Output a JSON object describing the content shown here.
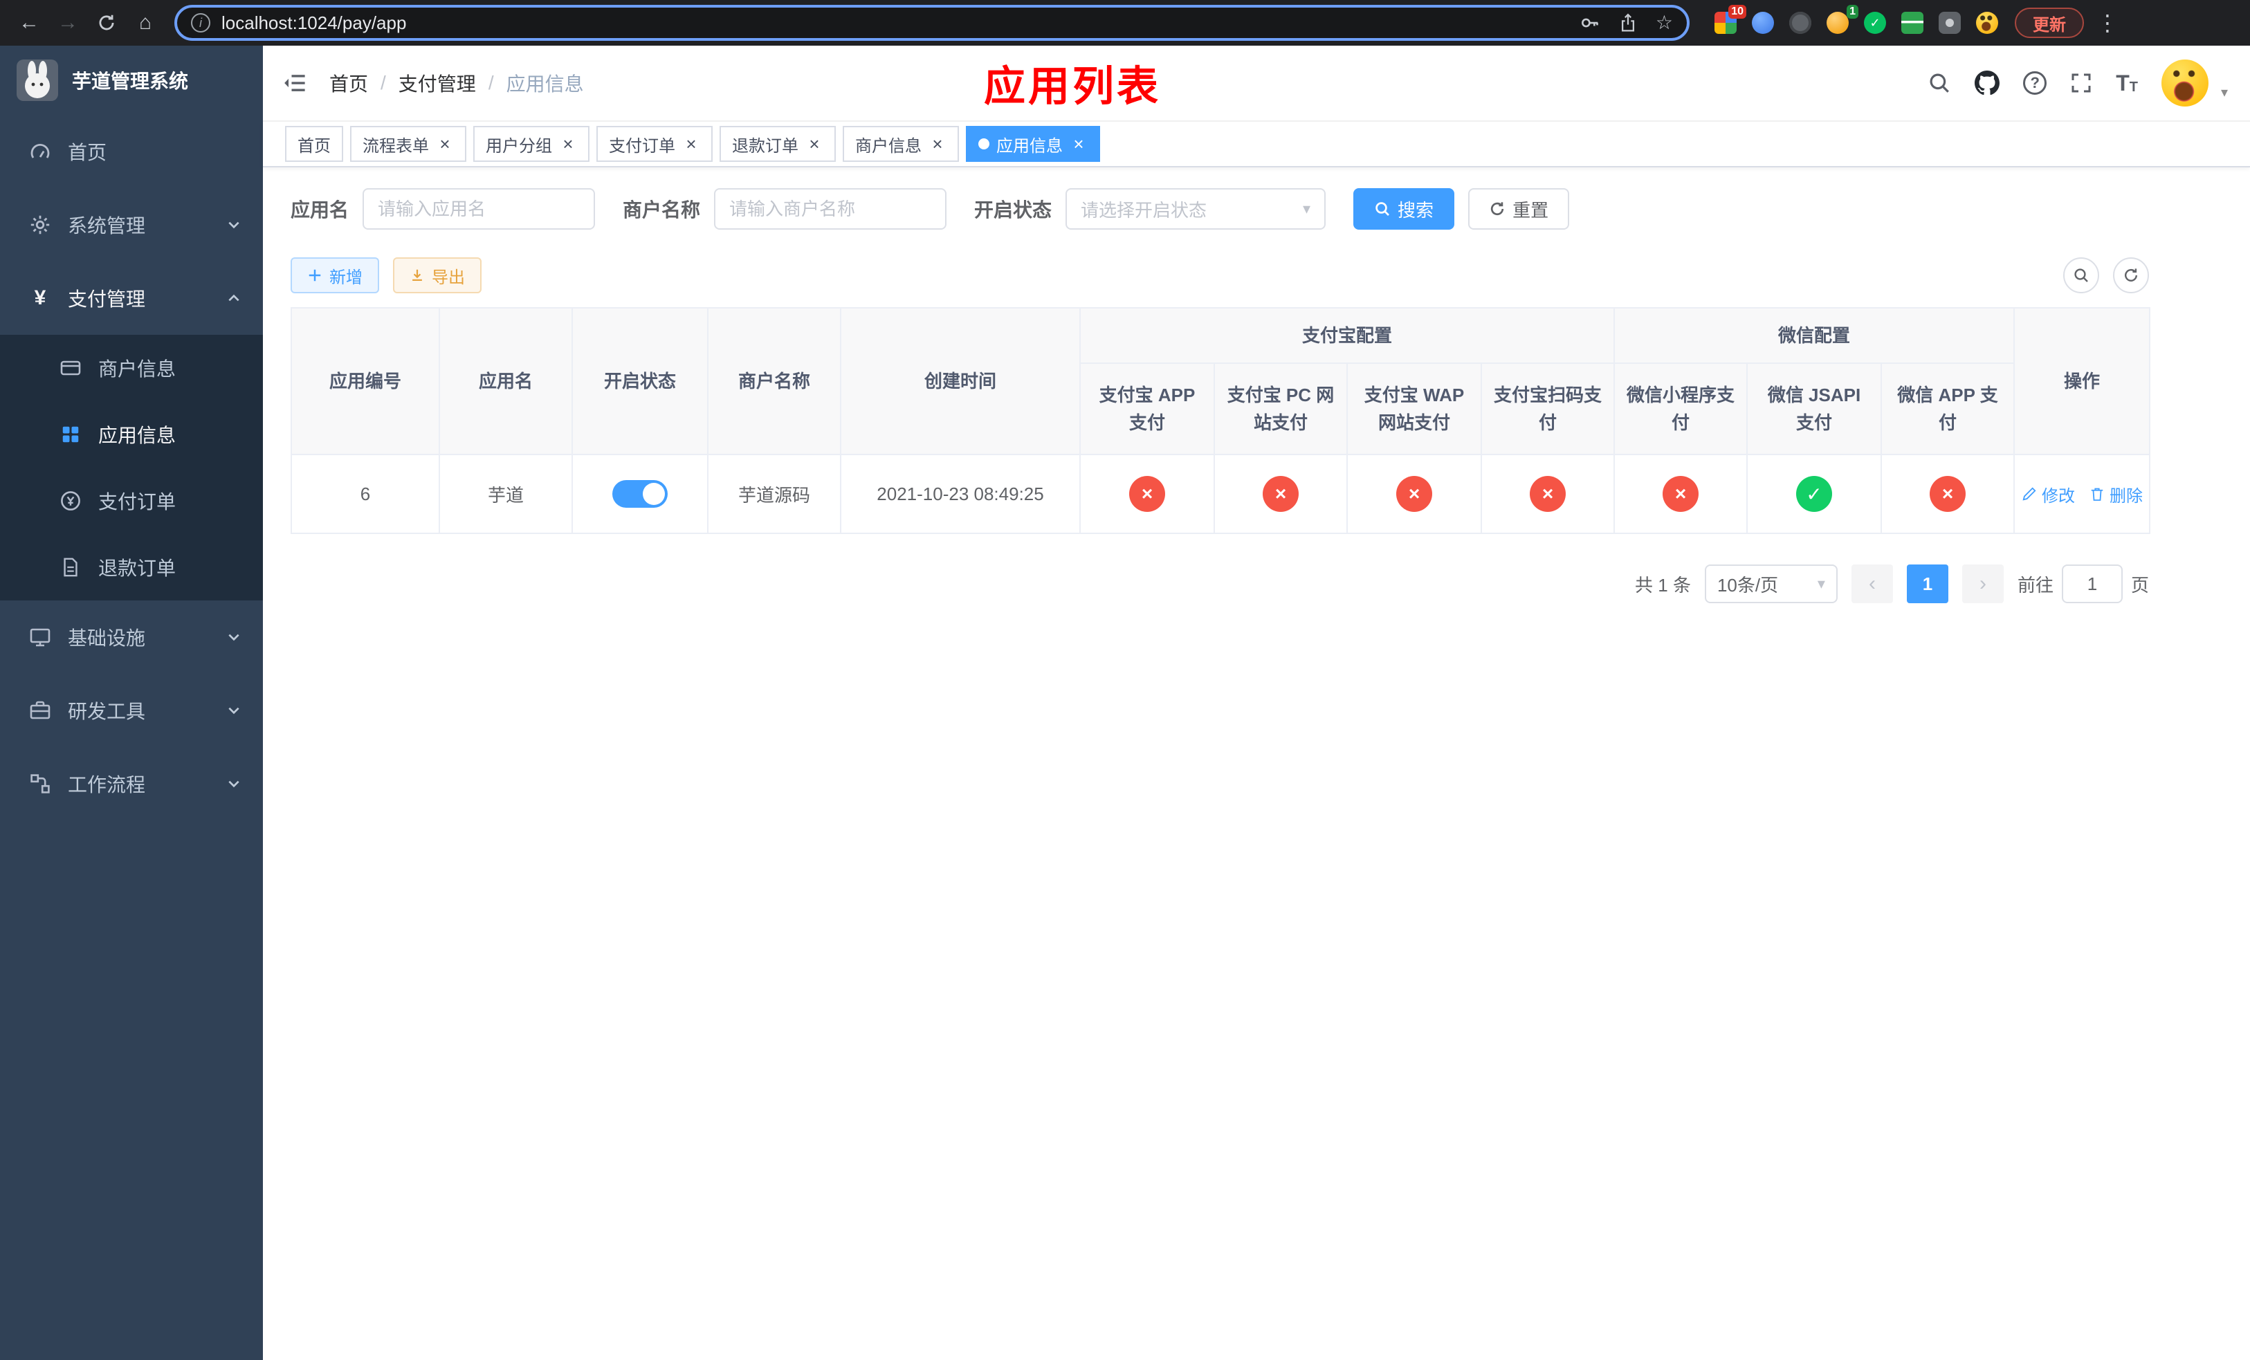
{
  "browser": {
    "url": "localhost:1024/pay/app",
    "update_button": "更新",
    "extension_badge_count": "10",
    "translate_badge_count": "1"
  },
  "glyphs": {
    "back": "←",
    "forward": "→",
    "home": "⌂",
    "info": "i",
    "star": "☆",
    "menu": "⋮",
    "question": "?",
    "caret": "▾",
    "slash": "/",
    "prev": "‹",
    "next": "›",
    "check": "✓",
    "cross": "×",
    "yen": "¥",
    "font_large": "T",
    "font_small": "T"
  },
  "sidebar": {
    "logo_title": "芋道管理系统",
    "items": {
      "home": "首页",
      "system": "系统管理",
      "payment": "支付管理",
      "merchant": "商户信息",
      "app": "应用信息",
      "pay_order": "支付订单",
      "refund_order": "退款订单",
      "infra": "基础设施",
      "devtools": "研发工具",
      "workflow": "工作流程"
    }
  },
  "header": {
    "breadcrumb_home": "首页",
    "breadcrumb_section": "支付管理",
    "breadcrumb_current": "应用信息",
    "page_title": "应用列表"
  },
  "tabs": [
    {
      "label": "首页",
      "closable": false,
      "active": false
    },
    {
      "label": "流程表单",
      "closable": true,
      "active": false
    },
    {
      "label": "用户分组",
      "closable": true,
      "active": false
    },
    {
      "label": "支付订单",
      "closable": true,
      "active": false
    },
    {
      "label": "退款订单",
      "closable": true,
      "active": false
    },
    {
      "label": "商户信息",
      "closable": true,
      "active": false
    },
    {
      "label": "应用信息",
      "closable": true,
      "active": true
    }
  ],
  "filters": {
    "app_name_label": "应用名",
    "app_name_placeholder": "请输入应用名",
    "merchant_label": "商户名称",
    "merchant_placeholder": "请输入商户名称",
    "status_label": "开启状态",
    "status_placeholder": "请选择开启状态",
    "search_button": "搜索",
    "reset_button": "重置"
  },
  "toolbar": {
    "add_button": "新增",
    "export_button": "导出"
  },
  "table": {
    "groups": {
      "alipay": "支付宝配置",
      "wechat": "微信配置"
    },
    "columns": {
      "id": "应用编号",
      "name": "应用名",
      "status": "开启状态",
      "merchant": "商户名称",
      "created": "创建时间",
      "alipay_app": "支付宝 APP 支付",
      "alipay_pc": "支付宝 PC 网站支付",
      "alipay_wap": "支付宝 WAP 网站支付",
      "alipay_qr": "支付宝扫码支付",
      "wx_mini": "微信小程序支付",
      "wx_jsapi": "微信 JSAPI 支付",
      "wx_app": "微信 APP 支付",
      "actions": "操作"
    },
    "rows": [
      {
        "id": "6",
        "name": "芋道",
        "enabled": true,
        "merchant": "芋道源码",
        "created": "2021-10-23 08:49:25",
        "alipay_app": false,
        "alipay_pc": false,
        "alipay_wap": false,
        "alipay_qr": false,
        "wx_mini": false,
        "wx_jsapi": true,
        "wx_app": false,
        "edit_label": "修改",
        "delete_label": "删除"
      }
    ]
  },
  "pagination": {
    "total": "共 1 条",
    "page_size": "10条/页",
    "current_page": "1",
    "goto_label": "前往",
    "goto_value": "1",
    "goto_unit": "页"
  },
  "colors": {
    "accent": "#409eff",
    "danger": "#f55445",
    "success": "#13ce66",
    "warning": "#e6a23c",
    "title_red": "#ff0000",
    "sidebar_bg": "#304156",
    "submenu_bg": "#1f2d3d"
  }
}
